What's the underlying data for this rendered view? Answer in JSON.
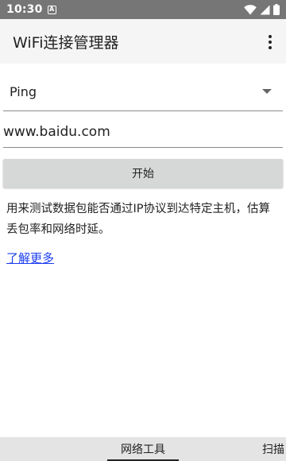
{
  "status_bar": {
    "time": "10:30",
    "app_icon_letter": "A"
  },
  "app_bar": {
    "title": "WiFi连接管理器"
  },
  "tool": {
    "selected": "Ping",
    "host_value": "www.baidu.com",
    "start_label": "开始",
    "description": "用来测试数据包能否通过IP协议到达特定主机，估算丢包率和网络时延。",
    "learn_more": "了解更多"
  },
  "tabs": {
    "network_tools": "网络工具",
    "scan": "扫描"
  },
  "colors": {
    "status_bar": "#767676",
    "app_bar": "#f5f5f5",
    "button": "#d6d7d7",
    "link": "#1a3cf0",
    "tab_bar": "#e4e4e4"
  }
}
